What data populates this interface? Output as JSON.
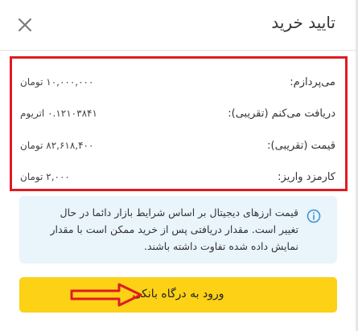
{
  "dialog": {
    "title": "تایید خرید"
  },
  "details": {
    "rows": [
      {
        "label": "می‌پردازم:",
        "value": "۱۰,۰۰۰,۰۰۰ تومان"
      },
      {
        "label": "دریافت می‌کنم (تقریبی):",
        "value": "۰.۱۲۱۰۳۸۴۱ اتریوم"
      },
      {
        "label": "قیمت (تقریبی):",
        "value": "۸۲,۶۱۸,۴۰۰ تومان"
      },
      {
        "label": "کارمزد واریز:",
        "value": "۲,۰۰۰ تومان"
      }
    ]
  },
  "notice": {
    "line1": "قیمت ارزهای دیجیتال بر اساس شرایط بازار دائما در حال",
    "line2": "تغییر است. مقدار دریافتی پس از خرید ممکن است با مقدار",
    "line3": "نمایش داده شده تفاوت داشته باشند."
  },
  "actions": {
    "pay_label": "ورود به درگاه بانکی"
  },
  "icons": {
    "close": "close-icon",
    "info": "info-icon",
    "arrow": "arrow-right-icon"
  },
  "colors": {
    "highlight": "#e01b24",
    "button": "#fcd116",
    "notice_bg": "#e9f4fb",
    "info_icon": "#3b8fd1"
  }
}
